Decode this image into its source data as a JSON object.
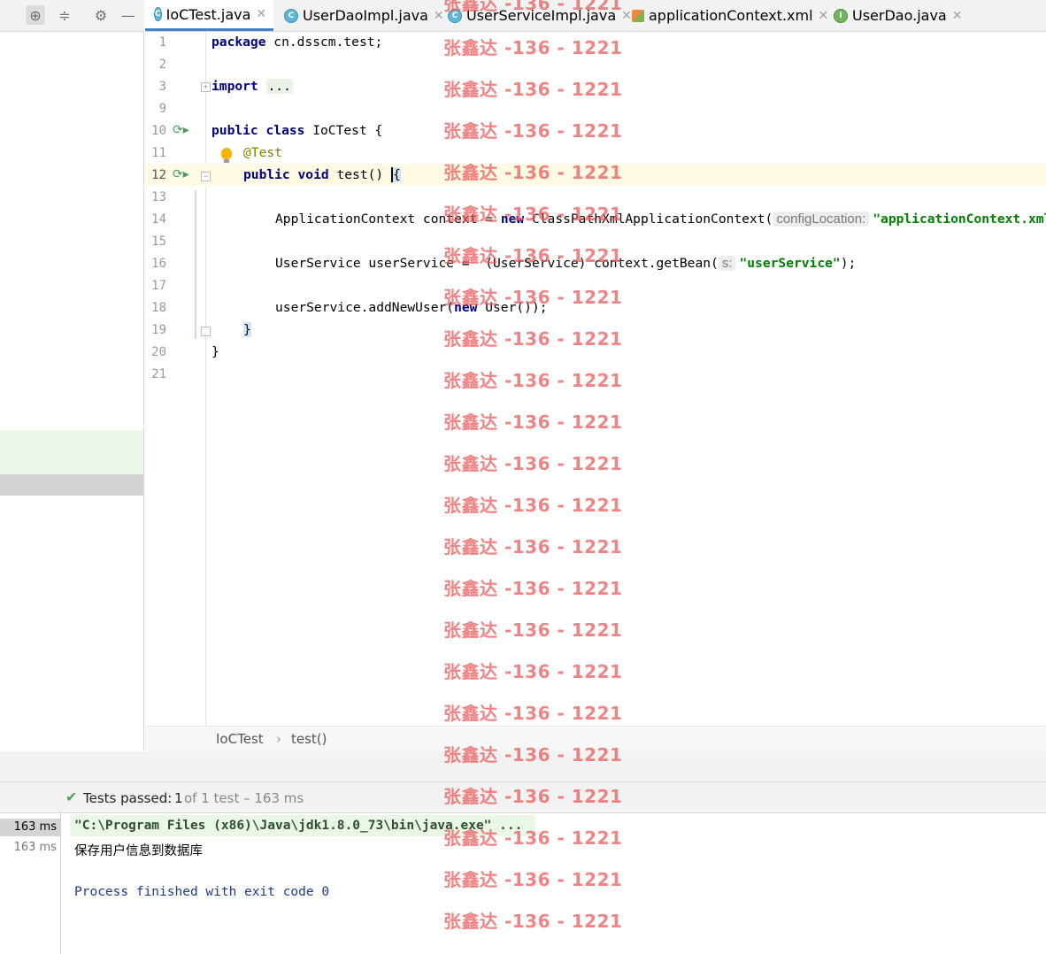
{
  "tabs": [
    {
      "label": "IoCTest.java",
      "icon": "class-file-icon",
      "selected": true
    },
    {
      "label": "UserDaoImpl.java",
      "icon": "class-file-icon"
    },
    {
      "label": "UserServiceImpl.java",
      "icon": "class-file-icon"
    },
    {
      "label": "applicationContext.xml",
      "icon": "xml-file-icon"
    },
    {
      "label": "UserDao.java",
      "icon": "interface-file-icon"
    }
  ],
  "tab_icon_letters": {
    "class": "C",
    "interface": "I"
  },
  "toolbar_icons": [
    "locate-icon",
    "collapse-icon",
    "gear-icon",
    "minimize-icon"
  ],
  "editor": {
    "line_numbers": [
      "1",
      "2",
      "3",
      "9",
      "10",
      "11",
      "12",
      "13",
      "14",
      "15",
      "16",
      "17",
      "18",
      "19",
      "20",
      "21"
    ],
    "code": {
      "l1_kw": "package",
      "l1_rest": " cn.dsscm.test;",
      "l3_kw": "import",
      "l3_fold": "...",
      "l10_kw1": "public",
      "l10_kw2": "class",
      "l10_rest": " IoCTest {",
      "l11_ann": "@Test",
      "l12_kw1": "public",
      "l12_kw2": "void",
      "l12_rest": " test() ",
      "l12_brace": "{",
      "l14_a": "ApplicationContext context = ",
      "l14_kw": "new",
      "l14_b": " ClassPathXmlApplicationContext(",
      "l14_hint": "configLocation:",
      "l14_str": "\"applicationContext.xml\");",
      "l16_a": "UserService userService =  (UserService) context.getBean(",
      "l16_hint": "s:",
      "l16_str": "\"userService\"",
      "l16_b": ");",
      "l18_a": "userService.addNewUser(",
      "l18_kw": "new",
      "l18_b": " User());",
      "l19_brace": "}",
      "l20": "}"
    }
  },
  "breadcrumb": {
    "class_name": "IoCTest",
    "separator": "›",
    "method_name": "test()"
  },
  "run": {
    "status_prefix": "Tests passed:",
    "passed_count": "1",
    "status_suffix": "of 1 test – 163 ms",
    "times": [
      "163 ms",
      "163 ms"
    ],
    "console_lines": [
      "\"C:\\Program Files (x86)\\Java\\jdk1.8.0_73\\bin\\java.exe\" ...",
      "保存用户信息到数据库",
      "",
      "Process finished with exit code 0"
    ]
  },
  "watermark": "张鑫达 -136 - 1221",
  "colors": {
    "keyword": "#000080",
    "string": "#008000",
    "annotation": "#808000",
    "watermark": "#eb5a5a",
    "tab_underline": "#4083c9",
    "process_text": "#1e3a8a"
  }
}
